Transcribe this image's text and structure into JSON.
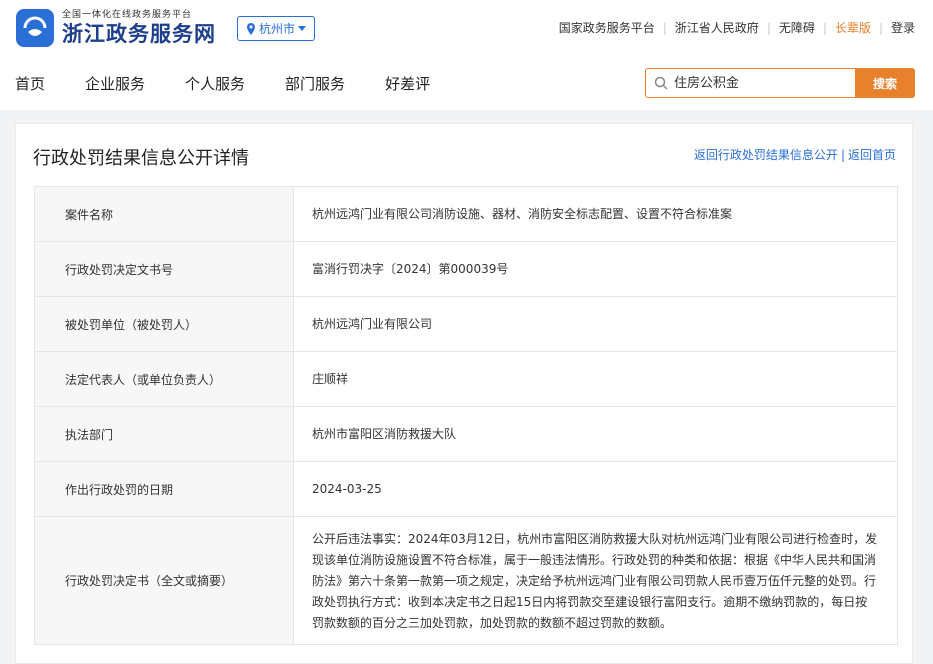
{
  "header": {
    "logo_small": "全国一体化在线政务服务平台",
    "logo_big": "浙江政务服务网",
    "city": "杭州市",
    "links": [
      "国家政务服务平台",
      "浙江省人民政府",
      "无障碍",
      "长辈版",
      "登录"
    ]
  },
  "nav": [
    "首页",
    "企业服务",
    "个人服务",
    "部门服务",
    "好差评"
  ],
  "search": {
    "placeholder": "住房公积金",
    "button": "搜索"
  },
  "card": {
    "title": "行政处罚结果信息公开详情",
    "back_list": "返回行政处罚结果信息公开",
    "back_home": "返回首页"
  },
  "details": [
    {
      "label": "案件名称",
      "value": "杭州远鸿门业有限公司消防设施、器材、消防安全标志配置、设置不符合标准案"
    },
    {
      "label": "行政处罚决定文书号",
      "value": "富消行罚决字〔2024〕第000039号"
    },
    {
      "label": "被处罚单位（被处罚人）",
      "value": "杭州远鸿门业有限公司"
    },
    {
      "label": "法定代表人（或单位负责人）",
      "value": "庄顺祥"
    },
    {
      "label": "执法部门",
      "value": "杭州市富阳区消防救援大队"
    },
    {
      "label": "作出行政处罚的日期",
      "value": "2024-03-25"
    },
    {
      "label": "行政处罚决定书（全文或摘要）",
      "value": "公开后违法事实：2024年03月12日，杭州市富阳区消防救援大队对杭州远鸿门业有限公司进行检查时，发现该单位消防设施设置不符合标准，属于一般违法情形。行政处罚的种类和依据：根据《中华人民共和国消防法》第六十条第一款第一项之规定，决定给予杭州远鸿门业有限公司罚款人民币壹万伍仟元整的处罚。行政处罚执行方式：收到本决定书之日起15日内将罚款交至建设银行富阳支行。逾期不缴纳罚款的，每日按罚款数额的百分之三加处罚款，加处罚款的数额不超过罚款的数额。"
    }
  ],
  "colors": {
    "brand_blue": "#2a6fd6",
    "accent_orange": "#e8812e"
  }
}
